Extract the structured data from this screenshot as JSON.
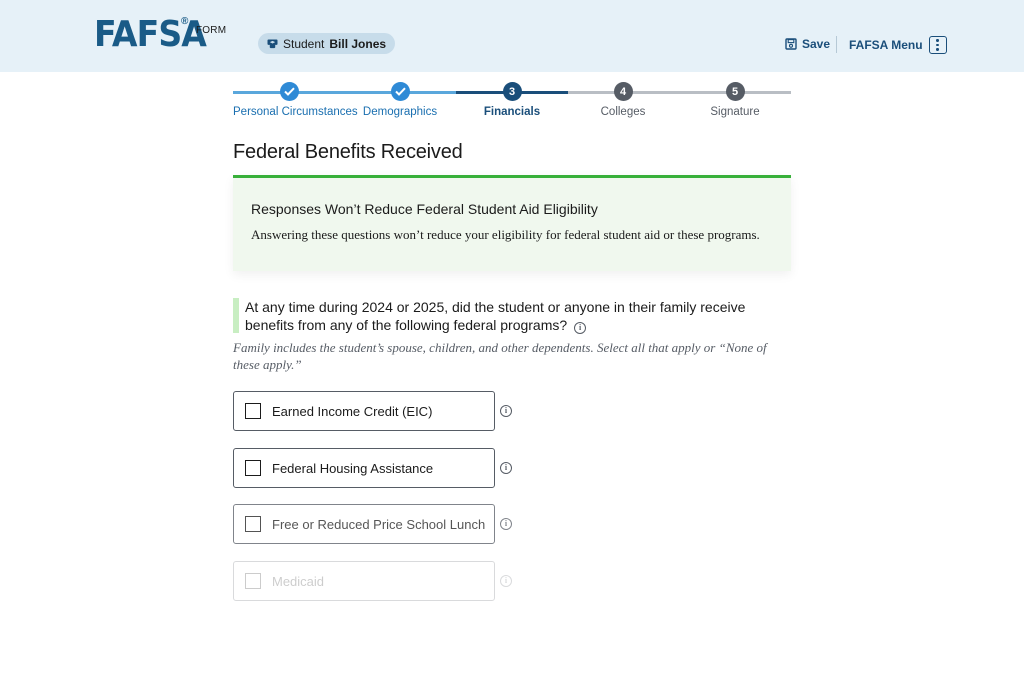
{
  "header": {
    "logo_text": "FAFSA",
    "logo_reg": "®",
    "logo_suffix": "FORM",
    "student_prefix": "Student",
    "student_name": "Bill Jones",
    "save_label": "Save",
    "menu_label": "FAFSA Menu",
    "icons": {
      "student": "graduation-cap-icon",
      "save": "floppy-disk-icon",
      "menu": "kebab-menu-icon"
    }
  },
  "stepper": {
    "steps": [
      {
        "number": "",
        "label": "Personal Circumstances",
        "state": "complete"
      },
      {
        "number": "",
        "label": "Demographics",
        "state": "complete"
      },
      {
        "number": "3",
        "label": "Financials",
        "state": "current"
      },
      {
        "number": "4",
        "label": "Colleges",
        "state": "incomplete"
      },
      {
        "number": "5",
        "label": "Signature",
        "state": "incomplete"
      }
    ]
  },
  "page": {
    "title": "Federal Benefits Received"
  },
  "alert": {
    "heading": "Responses Won’t Reduce Federal Student Aid Eligibility",
    "body": "Answering these questions won’t reduce your eligibility for federal student aid or these programs."
  },
  "question": {
    "text": "At any time during 2024 or 2025, did the student or anyone in their family receive benefits from any of the following federal programs?",
    "hint": "Family includes the student’s spouse, children, and other dependents. Select all that apply or “None of these apply.”",
    "info_glyph": "i",
    "options": [
      {
        "label": "Earned Income Credit (EIC)",
        "checked": false
      },
      {
        "label": "Federal Housing Assistance",
        "checked": false
      },
      {
        "label": "Free or Reduced Price School Lunch",
        "checked": false
      },
      {
        "label": "Medicaid",
        "checked": false
      }
    ]
  },
  "colors": {
    "header_bg": "#e6f1f8",
    "brand_blue": "#1a5b87",
    "step_complete": "#2f8ad6",
    "step_current": "#1a4e7a",
    "step_incomplete": "#565c65",
    "alert_border": "#38b03a",
    "alert_bg": "#f0f8ee",
    "question_bar": "#c8eec2"
  }
}
